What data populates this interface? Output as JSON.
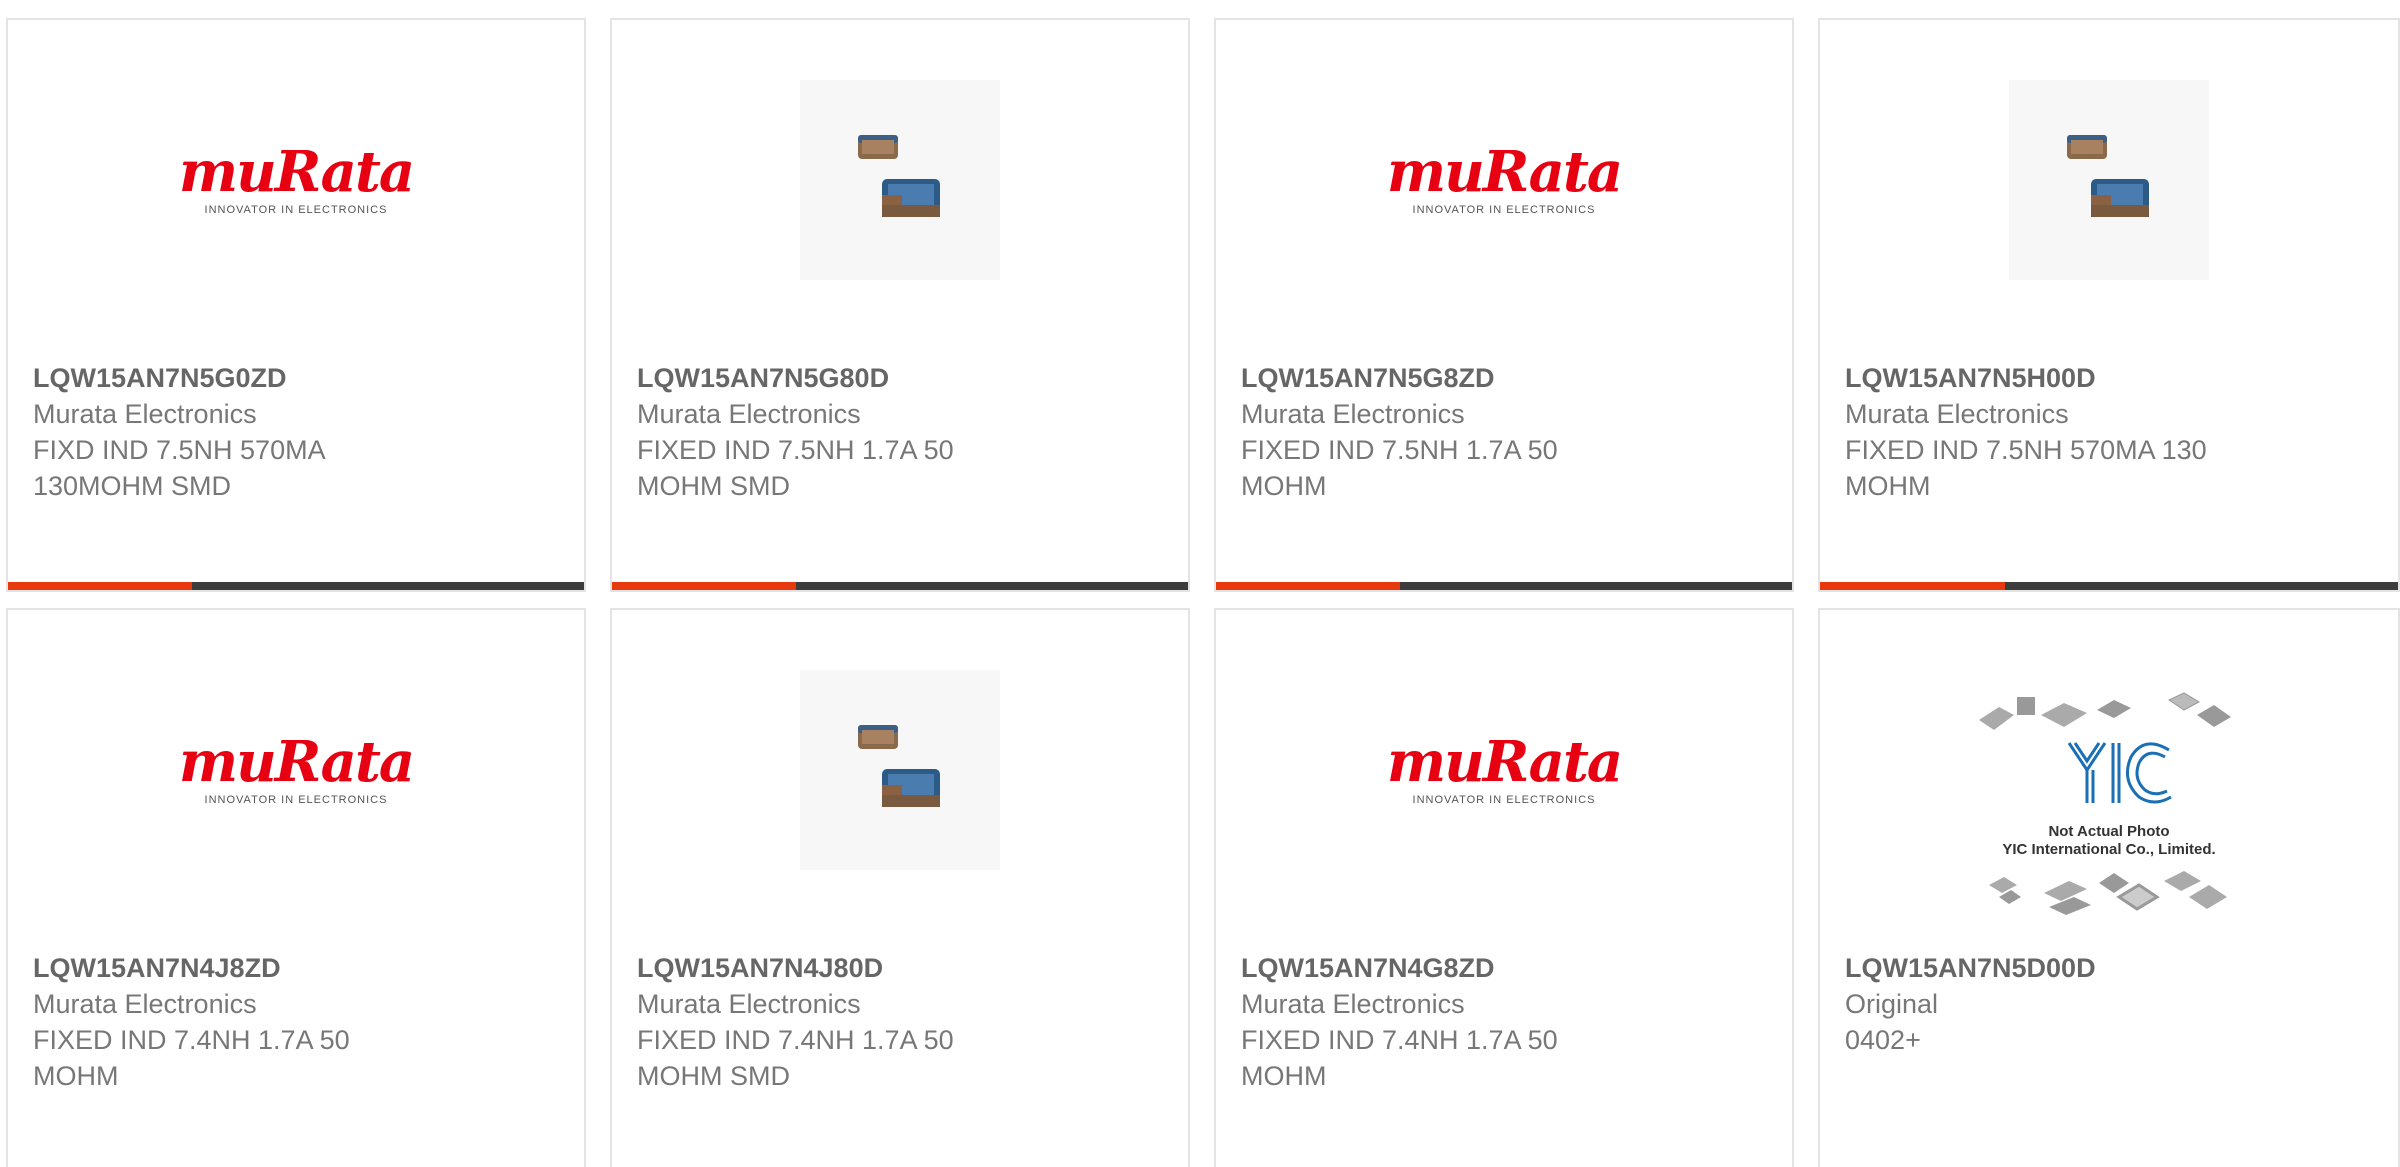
{
  "colors": {
    "accent": "#e8380d",
    "bar": "#3d3d3d",
    "murata_red": "#e60012",
    "yic_blue": "#1a6fb5"
  },
  "cards": [
    {
      "part_number": "LQW15AN7N5G0ZD",
      "manufacturer": "Murata Electronics",
      "desc_line1": "FIXD IND 7.5NH 570MA",
      "desc_line2": "130MOHM SMD",
      "image": "murata-logo",
      "logo_word": "muRata",
      "logo_tag": "INNOVATOR IN ELECTRONICS",
      "show_bar": true
    },
    {
      "part_number": "LQW15AN7N5G80D",
      "manufacturer": "Murata Electronics",
      "desc_line1": "FIXED IND 7.5NH 1.7A 50",
      "desc_line2": "MOHM SMD",
      "image": "inductor-photo",
      "show_bar": true
    },
    {
      "part_number": "LQW15AN7N5G8ZD",
      "manufacturer": "Murata Electronics",
      "desc_line1": "FIXED IND 7.5NH 1.7A 50",
      "desc_line2": "MOHM",
      "image": "murata-logo",
      "logo_word": "muRata",
      "logo_tag": "INNOVATOR IN ELECTRONICS",
      "show_bar": true
    },
    {
      "part_number": "LQW15AN7N5H00D",
      "manufacturer": "Murata Electronics",
      "desc_line1": "FIXED IND 7.5NH 570MA 130",
      "desc_line2": "MOHM",
      "image": "inductor-photo",
      "show_bar": true
    },
    {
      "part_number": "LQW15AN7N4J8ZD",
      "manufacturer": "Murata Electronics",
      "desc_line1": "FIXED IND 7.4NH 1.7A 50",
      "desc_line2": "MOHM",
      "image": "murata-logo",
      "logo_word": "muRata",
      "logo_tag": "INNOVATOR IN ELECTRONICS",
      "show_bar": false
    },
    {
      "part_number": "LQW15AN7N4J80D",
      "manufacturer": "Murata Electronics",
      "desc_line1": "FIXED IND 7.4NH 1.7A 50",
      "desc_line2": "MOHM SMD",
      "image": "inductor-photo",
      "show_bar": false
    },
    {
      "part_number": "LQW15AN7N4G8ZD",
      "manufacturer": "Murata Electronics",
      "desc_line1": "FIXED IND 7.4NH 1.7A 50",
      "desc_line2": "MOHM",
      "image": "murata-logo",
      "logo_word": "muRata",
      "logo_tag": "INNOVATOR IN ELECTRONICS",
      "show_bar": false
    },
    {
      "part_number": "LQW15AN7N5D00D",
      "manufacturer": "Original",
      "desc_line1": "0402+",
      "desc_line2": "",
      "image": "yic-placeholder",
      "yic_line1": "Not Actual Photo",
      "yic_line2": "YIC International Co., Limited.",
      "yic_mark": "YIC",
      "show_bar": false
    }
  ],
  "progress_fraction": 0.32
}
